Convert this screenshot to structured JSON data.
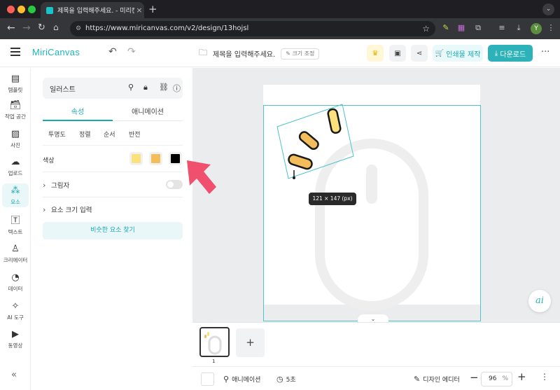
{
  "browser": {
    "tab_title": "제목을 입력해주세요. - 미리캔버스",
    "tab_close": "×",
    "new_tab": "+",
    "url": "https://www.miricanvas.com/v2/design/13hojsl",
    "profile_initial": "Y"
  },
  "header": {
    "logo": "MiriCanvas",
    "doc_title": "제목을 입력해주세요.",
    "resize_label": "크기 조정",
    "print_label": "인쇄물 제작",
    "download_label": "다운로드",
    "more": "···"
  },
  "rail": {
    "items": [
      {
        "label": "템플릿",
        "icon": "template-icon"
      },
      {
        "label": "작업 공간",
        "icon": "workspace-icon"
      },
      {
        "label": "사진",
        "icon": "photo-icon"
      },
      {
        "label": "업로드",
        "icon": "upload-icon"
      },
      {
        "label": "요소",
        "icon": "elements-icon"
      },
      {
        "label": "텍스트",
        "icon": "text-icon"
      },
      {
        "label": "크리에이터",
        "icon": "creator-icon"
      },
      {
        "label": "데이터",
        "icon": "data-icon"
      },
      {
        "label": "AI 도구",
        "icon": "ai-tools-icon"
      },
      {
        "label": "동영상",
        "icon": "video-icon"
      }
    ],
    "active_index": 4
  },
  "panel": {
    "element_name": "일러스트",
    "tabs": [
      "속성",
      "애니메이션"
    ],
    "subtabs": [
      "투명도",
      "정렬",
      "순서",
      "반전"
    ],
    "color_label": "색상",
    "colors": [
      "#fbe17e",
      "#f4bd5c",
      "#000000"
    ],
    "shadow_label": "그림자",
    "shadow_enabled": false,
    "size_label": "요소 크기 입력",
    "similar_label": "비슷한 요소 찾기"
  },
  "canvas": {
    "size_tooltip": "121 × 147 (px)",
    "ai_label": "ai",
    "expand_icon": "⌄"
  },
  "pages": {
    "current_page": "1",
    "add_label": "+"
  },
  "bottombar": {
    "animation_label": "애니메이션",
    "duration_label": "5초",
    "design_editor_label": "디자인 에디터",
    "zoom_value": "96",
    "zoom_unit": "%",
    "minus": "−",
    "plus": "+",
    "more": "⋮"
  },
  "colors": {
    "accent": "#2db2b9",
    "selection": "#4cc4ca",
    "arrow": "#f04f6e"
  }
}
